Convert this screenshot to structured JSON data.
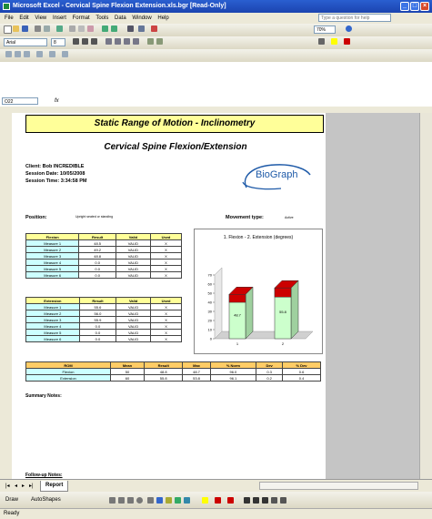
{
  "window": {
    "title": "Microsoft Excel - Cervical Spine Flexion Extension.xls.bgr [Read-Only]"
  },
  "menu": [
    "File",
    "Edit",
    "View",
    "Insert",
    "Format",
    "Tools",
    "Data",
    "Window",
    "Help"
  ],
  "help_box": {
    "placeholder": "Type a question for help"
  },
  "toolbar": {
    "zoom": "70%",
    "font": "Arial",
    "font_size": "8"
  },
  "formula_bar": {
    "name_box": "O22",
    "fx": "fx"
  },
  "sheet": {
    "title": "Static Range of Motion - Inclinometry",
    "subtitle": "Cervical Spine Flexion/Extension",
    "client": "Client: Bob INCREDIBLE",
    "session_date": "Session Date: 10/05/2008",
    "session_time": "Session Time: 3:34:58 PM",
    "logo_text": "BioGraph",
    "position_label": "Position:",
    "position_value": "Upright seated or standing",
    "movement_label": "Movement type:",
    "movement_value": "Active",
    "flexion_table": {
      "headers": [
        "Flexion",
        "Result",
        "Valid",
        "Used"
      ],
      "rows": [
        [
          "Measure 1",
          "48.5",
          "VALID",
          "X"
        ],
        [
          "Measure 2",
          "49.2",
          "VALID",
          "X"
        ],
        [
          "Measure 3",
          "48.8",
          "VALID",
          "X"
        ],
        [
          "Measure 4",
          "0.0",
          "VALID",
          "X"
        ],
        [
          "Measure 5",
          "0.0",
          "VALID",
          "X"
        ],
        [
          "Measure 6",
          "0.0",
          "VALID",
          "X"
        ]
      ]
    },
    "extension_table": {
      "headers": [
        "Extension",
        "Result",
        "Valid",
        "Used"
      ],
      "rows": [
        [
          "Measure 1",
          "55.6",
          "VALID",
          "X"
        ],
        [
          "Measure 2",
          "56.0",
          "VALID",
          "X"
        ],
        [
          "Measure 3",
          "55.9",
          "VALID",
          "X"
        ],
        [
          "Measure 4",
          "0.0",
          "VALID",
          "X"
        ],
        [
          "Measure 5",
          "0.0",
          "VALID",
          "X"
        ],
        [
          "Measure 6",
          "0.0",
          "VALID",
          "X"
        ]
      ]
    },
    "summary_table": {
      "headers": [
        "ROM",
        "Mean",
        "Result",
        "Max",
        "% Norm",
        "Dev",
        "% Dev"
      ],
      "rows": [
        [
          "Flexion",
          "50",
          "48.8",
          "48.7",
          "96.0",
          "0.3",
          "0.6"
        ],
        [
          "Extension",
          "60",
          "55.8",
          "53.8",
          "96.1",
          "0.2",
          "0.4"
        ]
      ]
    },
    "summary_notes": "Summary Notes:",
    "follow_up": "Follow-up Notes:"
  },
  "chart_data": {
    "type": "bar",
    "title": "1. Flexion - 2. Extension (degrees)",
    "categories": [
      "1",
      "2"
    ],
    "values": [
      48.7,
      55.8
    ],
    "bar_labels": [
      "48.7",
      "55.8"
    ],
    "ylim": [
      0,
      70
    ],
    "yticks": [
      "70",
      "60",
      "50",
      "40",
      "30",
      "20",
      "10",
      "0"
    ],
    "colors": {
      "front": "#ccffcc",
      "top": "#cc0000"
    }
  },
  "tabs": {
    "report": "Report"
  },
  "drawbar": {
    "draw": "Draw",
    "autoshapes": "AutoShapes"
  },
  "status": {
    "text": "Ready"
  }
}
